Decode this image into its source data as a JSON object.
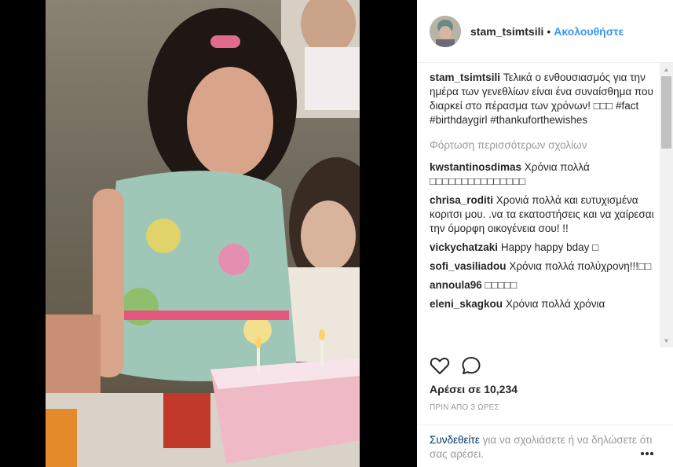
{
  "post": {
    "username": "stam_tsimtsili",
    "separator": "•",
    "follow_label": "Ακολουθήστε"
  },
  "caption": {
    "username": "stam_tsimtsili",
    "text": "Τελικά ο ενθουσιασμός για την ημέρα των γενεθλίων είναι ένα συναίσθημα που διαρκεί στο πέρασμα των χρόνων! □□□ #fact #birthdaygirl #thankuforthewishes"
  },
  "load_more_label": "Φόρτωση περισσότερων σχολίων",
  "comments": [
    {
      "user": "kwstantinosdimas",
      "text": "Χρόνια πολλά □□□□□□□□□□□□□□□"
    },
    {
      "user": "chrisa_roditi",
      "text": "Χρονιά πολλά και ευτυχισμένα κοριτσι μου. .να τα εκατοστήσεις και να χαίρεσαι την όμορφη οικογένεια σου! !!"
    },
    {
      "user": "vickychatzaki",
      "text": "Happy happy bday □"
    },
    {
      "user": "sofi_vasiliadou",
      "text": "Χρόνια πολλά πολύχρονη!!!□□"
    },
    {
      "user": "annoula96",
      "text": "□□□□□"
    },
    {
      "user": "eleni_skagkou",
      "text": "Χρόνια πολλά χρόνια"
    }
  ],
  "likes_label": "Αρέσει σε 10,234",
  "time_label": "ΠΡΙΝ ΑΠΟ 3 ΩΡΕΣ",
  "footer": {
    "login_link": "Συνδεθείτε",
    "rest_text": " για να σχολιάσετε ή να δηλώσετε ότι σας αρέσει."
  },
  "icons": {
    "like": "heart-icon",
    "comment": "speech-bubble-icon",
    "more": "more-options-icon"
  },
  "colors": {
    "link": "#3897f0",
    "muted": "#999999",
    "text": "#262626"
  }
}
